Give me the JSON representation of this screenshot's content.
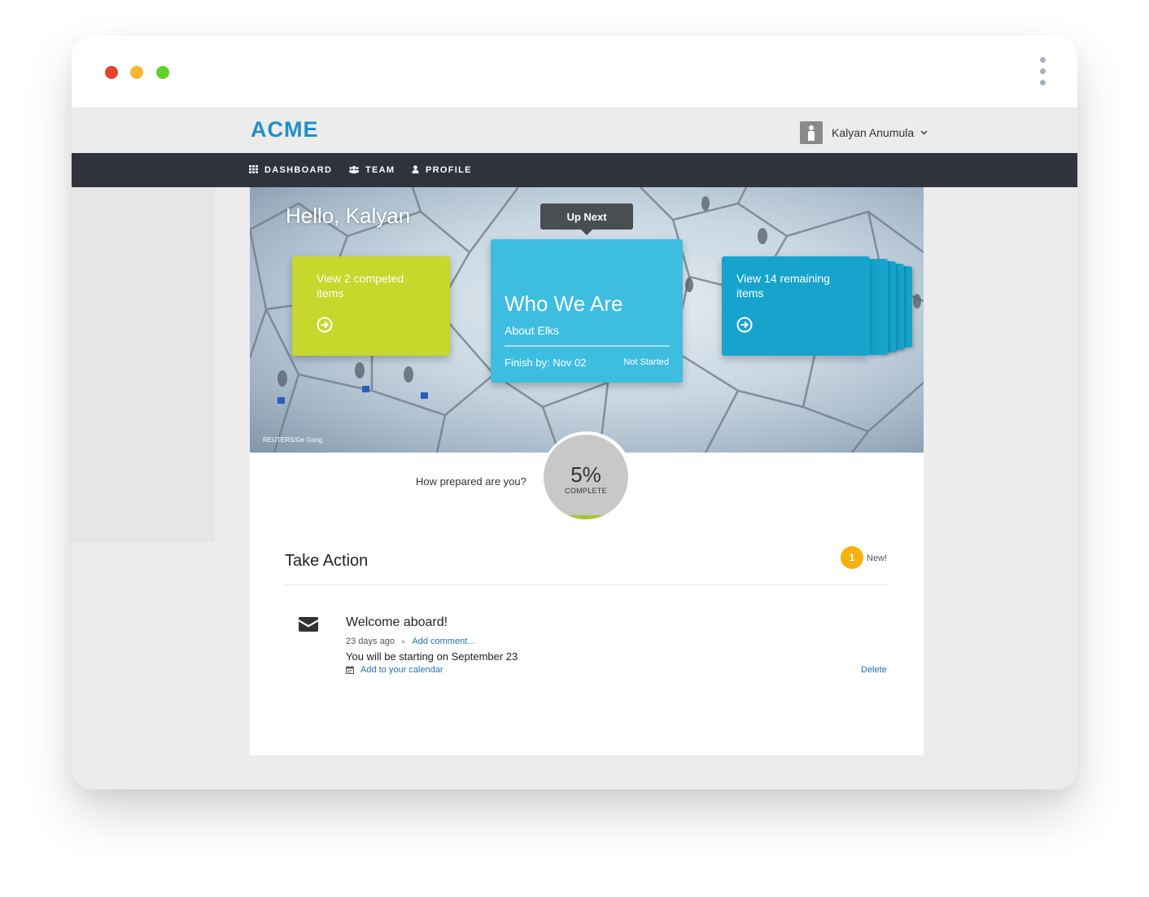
{
  "window": {
    "traffic_lights": [
      "#e0442b",
      "#f5b82e",
      "#5ed12a"
    ]
  },
  "header": {
    "logo": "ACME",
    "user_name": "Kalyan Anumula",
    "user_avatar_icon": "person-icon",
    "dropdown_icon": "chevron-down-icon"
  },
  "nav": {
    "items": [
      {
        "label": "DASHBOARD",
        "icon": "grid-icon"
      },
      {
        "label": "TEAM",
        "icon": "group-icon"
      },
      {
        "label": "PROFILE",
        "icon": "user-icon"
      }
    ]
  },
  "hero": {
    "greeting": "Hello, Kalyan",
    "photo_credit": "REUTERS/Ge Gong",
    "completed_card": {
      "label": "View 2 competed items",
      "icon": "arrow-circle-right-icon"
    },
    "upnext_tooltip": "Up Next",
    "main_card": {
      "title": "Who We Are",
      "subtitle": "About Elks",
      "finish_by": "Finish by: Nov 02",
      "status": "Not Started"
    },
    "remaining_card": {
      "label": "View 14 remaining items",
      "icon": "arrow-circle-right-icon"
    }
  },
  "progress": {
    "question": "How prepared are you?",
    "percent_text": "5%",
    "percent_value": 5,
    "label": "COMPLETE",
    "fill_color": "#a7c62a"
  },
  "take_action": {
    "title": "Take Action",
    "badge_count": "1",
    "badge_label": "New!",
    "items": [
      {
        "icon": "envelope-icon",
        "title": "Welcome aboard!",
        "time": "23 days ago",
        "comment_link": "Add comment...",
        "body": "You will be starting on September 23",
        "calendar_icon": "calendar-icon",
        "calendar_link": "Add to your calendar",
        "delete_label": "Delete"
      }
    ]
  }
}
